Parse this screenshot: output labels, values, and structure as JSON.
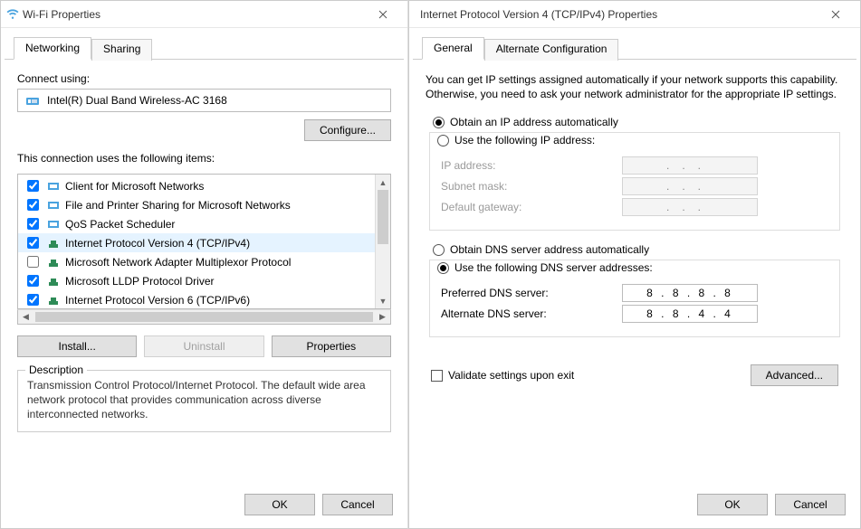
{
  "left": {
    "title": "Wi-Fi Properties",
    "tabs": {
      "networking": "Networking",
      "sharing": "Sharing"
    },
    "connect_using_label": "Connect using:",
    "adapter_name": "Intel(R) Dual Band Wireless-AC 3168",
    "configure_btn": "Configure...",
    "items_label": "This connection uses the following items:",
    "items": [
      {
        "checked": true,
        "label": "Client for Microsoft Networks"
      },
      {
        "checked": true,
        "label": "File and Printer Sharing for Microsoft Networks"
      },
      {
        "checked": true,
        "label": "QoS Packet Scheduler"
      },
      {
        "checked": true,
        "label": "Internet Protocol Version 4 (TCP/IPv4)",
        "selected": true
      },
      {
        "checked": false,
        "label": "Microsoft Network Adapter Multiplexor Protocol"
      },
      {
        "checked": true,
        "label": "Microsoft LLDP Protocol Driver"
      },
      {
        "checked": true,
        "label": "Internet Protocol Version 6 (TCP/IPv6)"
      }
    ],
    "install_btn": "Install...",
    "uninstall_btn": "Uninstall",
    "properties_btn": "Properties",
    "description_title": "Description",
    "description_text": "Transmission Control Protocol/Internet Protocol. The default wide area network protocol that provides communication across diverse interconnected networks.",
    "ok_btn": "OK",
    "cancel_btn": "Cancel"
  },
  "right": {
    "title": "Internet Protocol Version 4 (TCP/IPv4) Properties",
    "tabs": {
      "general": "General",
      "altconfig": "Alternate Configuration"
    },
    "intro": "You can get IP settings assigned automatically if your network supports this capability. Otherwise, you need to ask your network administrator for the appropriate IP settings.",
    "ip_auto": "Obtain an IP address automatically",
    "ip_manual": "Use the following IP address:",
    "ip_addr_label": "IP address:",
    "subnet_label": "Subnet mask:",
    "gateway_label": "Default gateway:",
    "dns_auto": "Obtain DNS server address automatically",
    "dns_manual": "Use the following DNS server addresses:",
    "pref_dns_label": "Preferred DNS server:",
    "alt_dns_label": "Alternate DNS server:",
    "pref_dns_value": "8 . 8 . 8 . 8",
    "alt_dns_value": "8 . 8 . 4 . 4",
    "validate_label": "Validate settings upon exit",
    "advanced_btn": "Advanced...",
    "ok_btn": "OK",
    "cancel_btn": "Cancel"
  }
}
